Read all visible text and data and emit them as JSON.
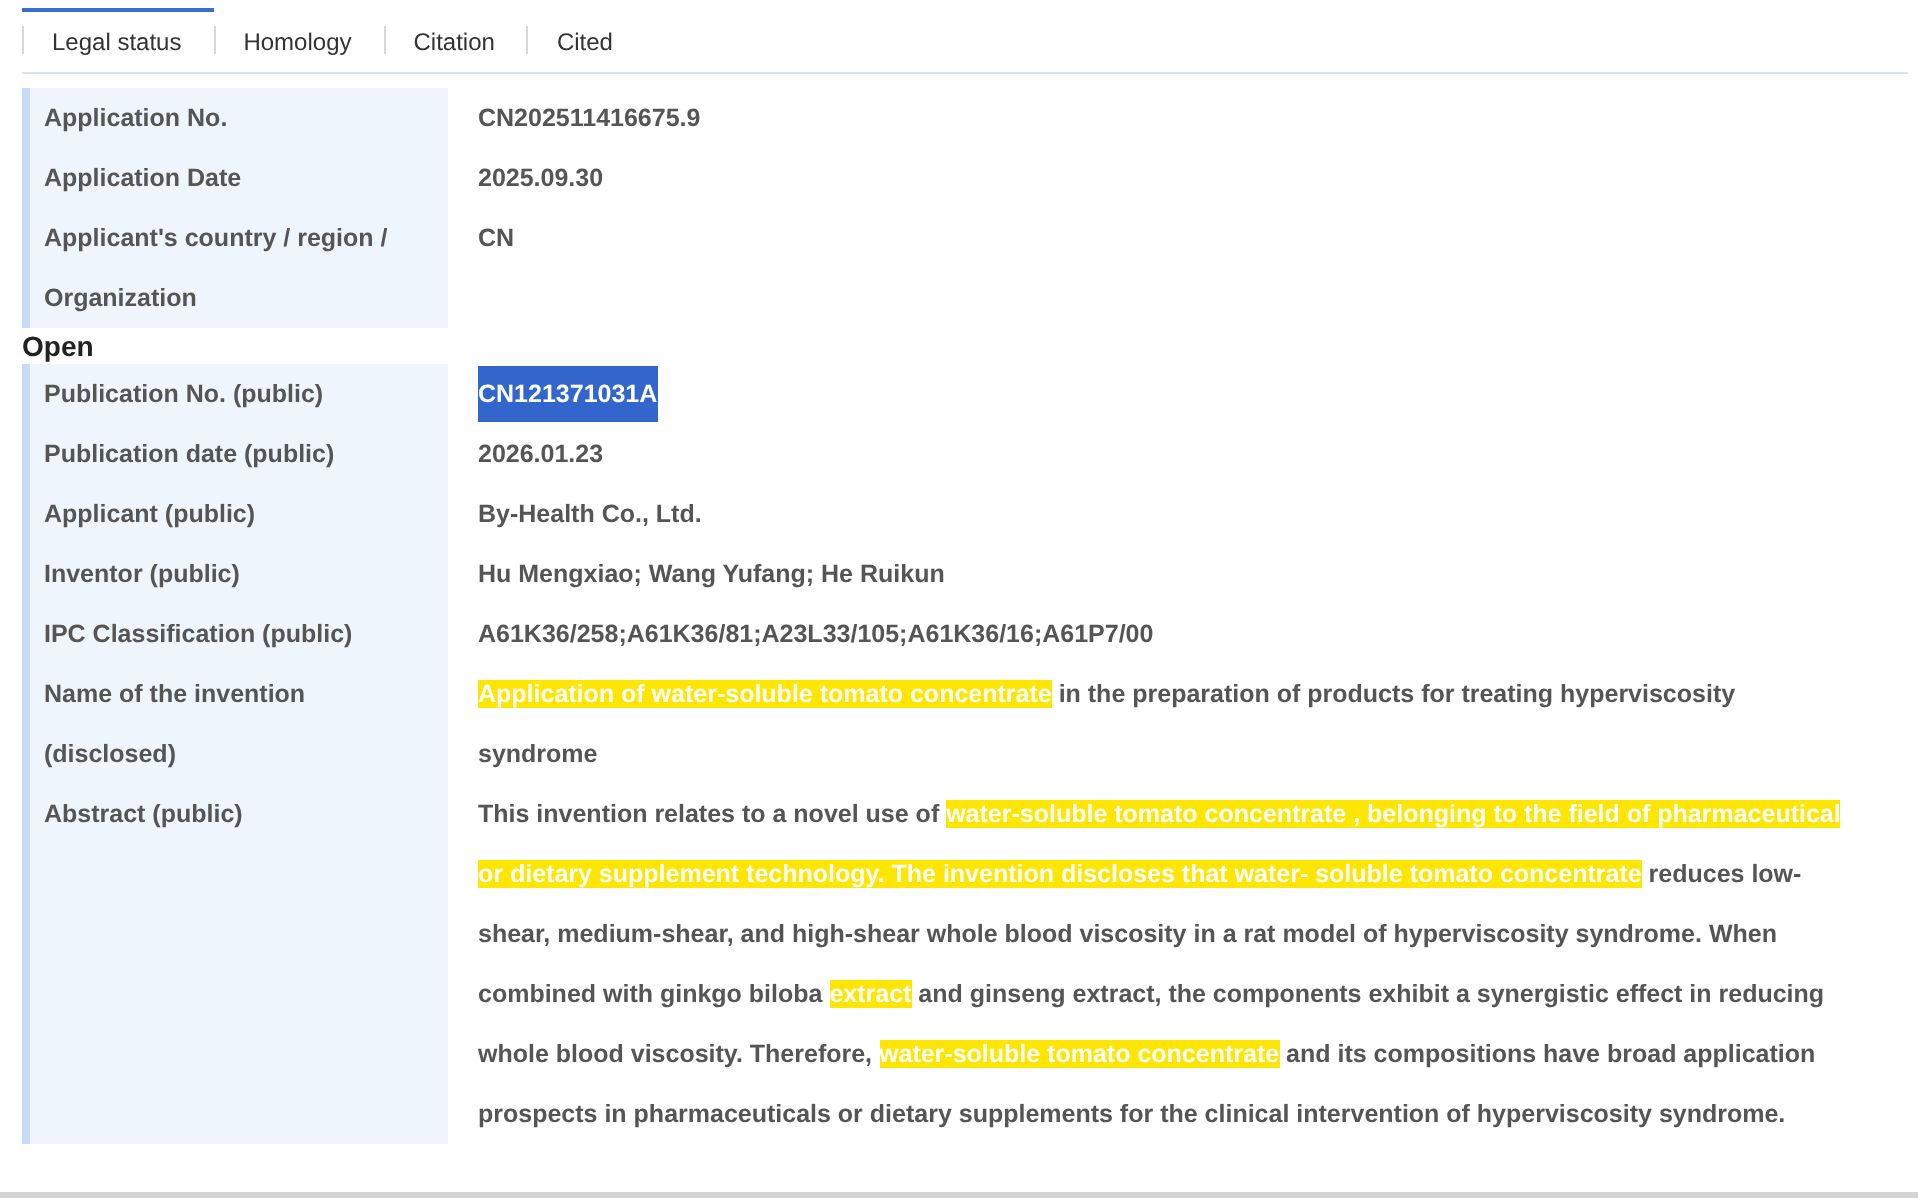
{
  "tabs": [
    {
      "label": "Legal status",
      "selected": true
    },
    {
      "label": "Homology",
      "selected": false
    },
    {
      "label": "Citation",
      "selected": false
    },
    {
      "label": "Cited",
      "selected": false
    }
  ],
  "sections": [
    {
      "rows": [
        {
          "label": "Application No.",
          "selected": false,
          "value": [
            {
              "text": "CN202511416675.9",
              "highlighted": false
            }
          ]
        },
        {
          "label": "Application Date",
          "selected": false,
          "value": [
            {
              "text": "2025.09.30",
              "highlighted": false
            }
          ]
        },
        {
          "label": "Applicant's country / region / Organization",
          "selected": false,
          "value": [
            {
              "text": "CN",
              "highlighted": false
            }
          ]
        }
      ]
    },
    {
      "heading": "Open",
      "rows": [
        {
          "label": "Publication No. (public)",
          "selected": true,
          "value": [
            {
              "text": "CN121371031A",
              "highlighted": false
            }
          ]
        },
        {
          "label": "Publication date (public)",
          "selected": false,
          "value": [
            {
              "text": "2026.01.23",
              "highlighted": false
            }
          ]
        },
        {
          "label": "Applicant (public)",
          "selected": false,
          "value": [
            {
              "text": "By-Health Co., Ltd.",
              "highlighted": false
            }
          ]
        },
        {
          "label": "Inventor (public)",
          "selected": false,
          "value": [
            {
              "text": "Hu Mengxiao; Wang Yufang; He Ruikun",
              "highlighted": false
            }
          ]
        },
        {
          "label": "IPC Classification (public)",
          "selected": false,
          "value": [
            {
              "text": "A61K36/258;A61K36/81;A23L33/105;A61K36/16;A61P7/00",
              "highlighted": false
            }
          ]
        },
        {
          "label": "Name of the invention (disclosed)",
          "selected": false,
          "value": [
            {
              "text": "Application of water-soluble tomato concentrate",
              "highlighted": true
            },
            {
              "text": " in the preparation of products for treating hyperviscosity syndrome",
              "highlighted": false
            }
          ]
        },
        {
          "label": "Abstract (public)",
          "selected": false,
          "value": [
            {
              "text": "This invention relates to a novel use of ",
              "highlighted": false
            },
            {
              "text": "water-soluble tomato concentrate , belonging to the field of pharmaceutical or dietary supplement technology. The invention discloses that water- soluble tomato concentrate",
              "highlighted": true
            },
            {
              "text": " reduces low-shear, medium-shear, and high-shear whole blood viscosity in a rat model of hyperviscosity syndrome. When combined with ginkgo biloba ",
              "highlighted": false
            },
            {
              "text": "extract",
              "highlighted": true
            },
            {
              "text": " and ginseng extract, the components exhibit a synergistic effect in reducing whole blood viscosity. Therefore, ",
              "highlighted": false
            },
            {
              "text": "water-soluble tomato concentrate",
              "highlighted": true
            },
            {
              "text": " and its compositions have broad application prospects in pharmaceuticals or dietary supplements for the clinical intervention of hyperviscosity syndrome.",
              "highlighted": false
            }
          ]
        }
      ]
    }
  ]
}
